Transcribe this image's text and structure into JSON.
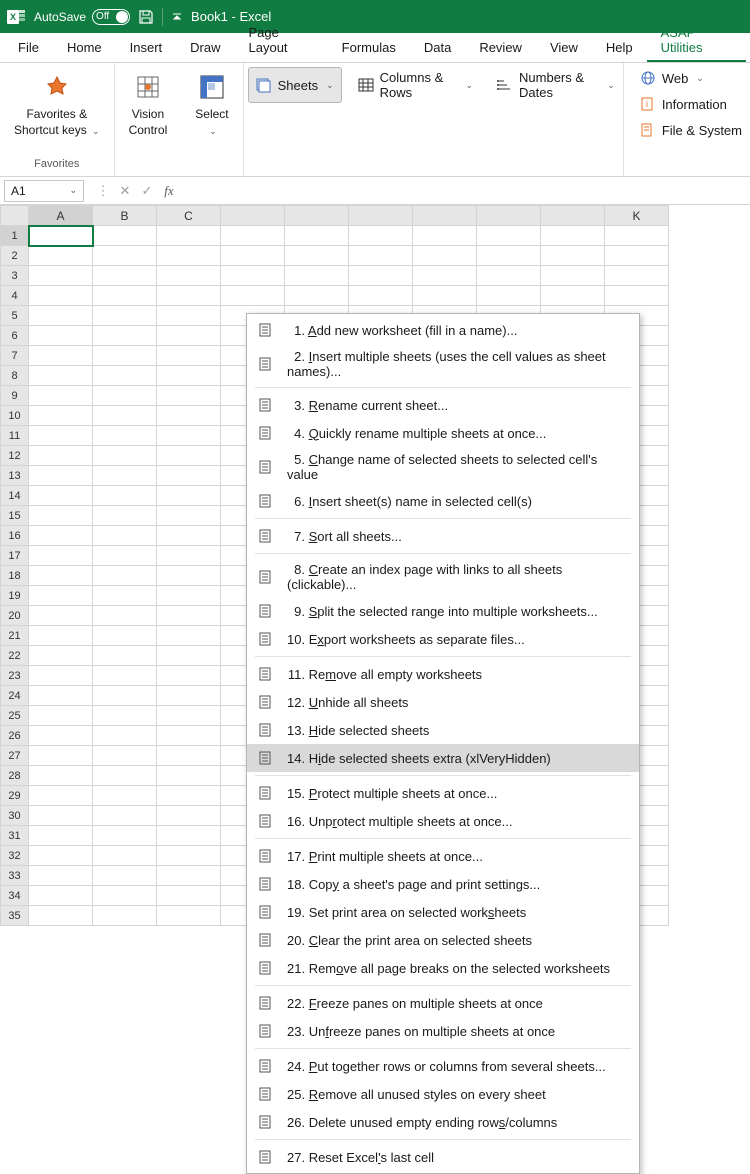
{
  "titlebar": {
    "autosave_label": "AutoSave",
    "autosave_state": "Off",
    "document": "Book1 - Excel"
  },
  "tabs": [
    "File",
    "Home",
    "Insert",
    "Draw",
    "Page Layout",
    "Formulas",
    "Data",
    "Review",
    "View",
    "Help",
    "ASAP Utilities"
  ],
  "active_tab": "ASAP Utilities",
  "ribbon": {
    "favorites": {
      "label": "Favorites &\nShortcut keys",
      "group": "Favorites"
    },
    "vision": {
      "label": "Vision\nControl"
    },
    "select": {
      "label": "Select"
    },
    "sheets": "Sheets",
    "columns": "Columns & Rows",
    "numbers": "Numbers & Dates",
    "web": "Web",
    "information": "Information",
    "filesystem": "File & System"
  },
  "namebox": "A1",
  "columns": [
    "A",
    "B",
    "C",
    "",
    "",
    "",
    "",
    "",
    "",
    "K"
  ],
  "rows": 35,
  "selected_cell": {
    "row": 1,
    "col": 0
  },
  "menu": [
    {
      "n": 1,
      "text": "Add new worksheet (fill in a name)...",
      "u": 0
    },
    {
      "n": 2,
      "text": "Insert multiple sheets (uses the cell values as sheet names)...",
      "u": 0
    },
    {
      "sep": true
    },
    {
      "n": 3,
      "text": "Rename current sheet...",
      "u": 0
    },
    {
      "n": 4,
      "text": "Quickly rename multiple sheets at once...",
      "u": 0
    },
    {
      "n": 5,
      "text": "Change name of selected sheets to selected cell's value",
      "u": 0
    },
    {
      "n": 6,
      "text": "Insert sheet(s) name in selected cell(s)",
      "u": 0
    },
    {
      "sep": true
    },
    {
      "n": 7,
      "text": "Sort all sheets...",
      "u": 0
    },
    {
      "sep": true
    },
    {
      "n": 8,
      "text": "Create an index page with links to all sheets (clickable)...",
      "u": 0
    },
    {
      "n": 9,
      "text": "Split the selected range into multiple worksheets...",
      "u": 0
    },
    {
      "n": 10,
      "text": "Export worksheets as separate files...",
      "u": 1
    },
    {
      "sep": true
    },
    {
      "n": 11,
      "text": "Remove all empty worksheets",
      "u": 2
    },
    {
      "n": 12,
      "text": "Unhide all sheets",
      "u": 0
    },
    {
      "n": 13,
      "text": "Hide selected sheets",
      "u": 0
    },
    {
      "n": 14,
      "text": "Hide selected sheets extra (xlVeryHidden)",
      "u": 1,
      "hover": true
    },
    {
      "sep": true
    },
    {
      "n": 15,
      "text": "Protect multiple sheets at once...",
      "u": 0
    },
    {
      "n": 16,
      "text": "Unprotect multiple sheets at once...",
      "u": 3
    },
    {
      "sep": true
    },
    {
      "n": 17,
      "text": "Print multiple sheets at once...",
      "u": 0
    },
    {
      "n": 18,
      "text": "Copy a sheet's page and print settings...",
      "u": 3
    },
    {
      "n": 19,
      "text": "Set print area on selected worksheets",
      "u": 31
    },
    {
      "n": 20,
      "text": "Clear the print area on selected sheets",
      "u": 0
    },
    {
      "n": 21,
      "text": "Remove all page breaks on the selected worksheets",
      "u": 3
    },
    {
      "sep": true
    },
    {
      "n": 22,
      "text": "Freeze panes on multiple sheets at once",
      "u": 0
    },
    {
      "n": 23,
      "text": "Unfreeze panes on multiple sheets at once",
      "u": 2
    },
    {
      "sep": true
    },
    {
      "n": 24,
      "text": "Put together rows or columns from several sheets...",
      "u": 0
    },
    {
      "n": 25,
      "text": "Remove all unused styles on every sheet",
      "u": 0
    },
    {
      "n": 26,
      "text": "Delete unused empty ending rows/columns",
      "u": 30
    },
    {
      "sep": true
    },
    {
      "n": 27,
      "text": "Reset Excel's last cell",
      "u": 11
    }
  ]
}
